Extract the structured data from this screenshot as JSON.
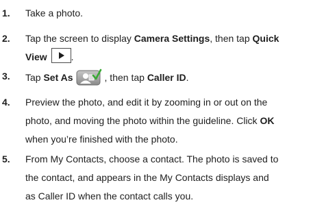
{
  "steps": [
    {
      "number": "1.",
      "lines": [
        {
          "segments": [
            {
              "text": "Take a photo.",
              "bold": false
            }
          ]
        }
      ]
    },
    {
      "number": "2.",
      "lines": [
        {
          "segments": [
            {
              "text": "Tap the screen to display ",
              "bold": false
            },
            {
              "text": "Camera Settings",
              "bold": true
            },
            {
              "text": ", then tap ",
              "bold": false
            },
            {
              "text": "Quick",
              "bold": true
            }
          ]
        },
        {
          "segments": [
            {
              "text": "View",
              "bold": true
            },
            {
              "icon": "play-icon"
            },
            {
              "text": ".",
              "bold": false
            }
          ]
        }
      ]
    },
    {
      "number": "3.",
      "lines": [
        {
          "segments": [
            {
              "text": "Tap ",
              "bold": false
            },
            {
              "text": "Set As",
              "bold": true
            },
            {
              "icon": "set-as-caller-id-icon"
            },
            {
              "text": ", then tap ",
              "bold": false
            },
            {
              "text": "Caller ID",
              "bold": true
            },
            {
              "text": ".",
              "bold": false
            }
          ]
        }
      ]
    },
    {
      "number": "4.",
      "lines": [
        {
          "segments": [
            {
              "text": "Preview the photo, and edit it by zooming in or out on the",
              "bold": false
            }
          ]
        },
        {
          "segments": [
            {
              "text": "photo, and moving the photo within the guideline.  Click ",
              "bold": false
            },
            {
              "text": "OK",
              "bold": true
            }
          ]
        },
        {
          "segments": [
            {
              "text": "when you’re finished with the photo.",
              "bold": false
            }
          ]
        }
      ]
    },
    {
      "number": "5.",
      "lines": [
        {
          "segments": [
            {
              "text": "From My Contacts, choose a contact. The photo is saved to",
              "bold": false
            }
          ]
        },
        {
          "segments": [
            {
              "text": "the contact, and appears in the My Contacts displays and",
              "bold": false
            }
          ]
        },
        {
          "segments": [
            {
              "text": "as Caller ID when the contact calls you.",
              "bold": false
            }
          ]
        }
      ]
    }
  ],
  "colors": {
    "text": "#1e1e1e",
    "icon_gradient_top": "#c7c7c7",
    "icon_gradient_bottom": "#8a8a8a",
    "checkmark": "#39a935"
  }
}
